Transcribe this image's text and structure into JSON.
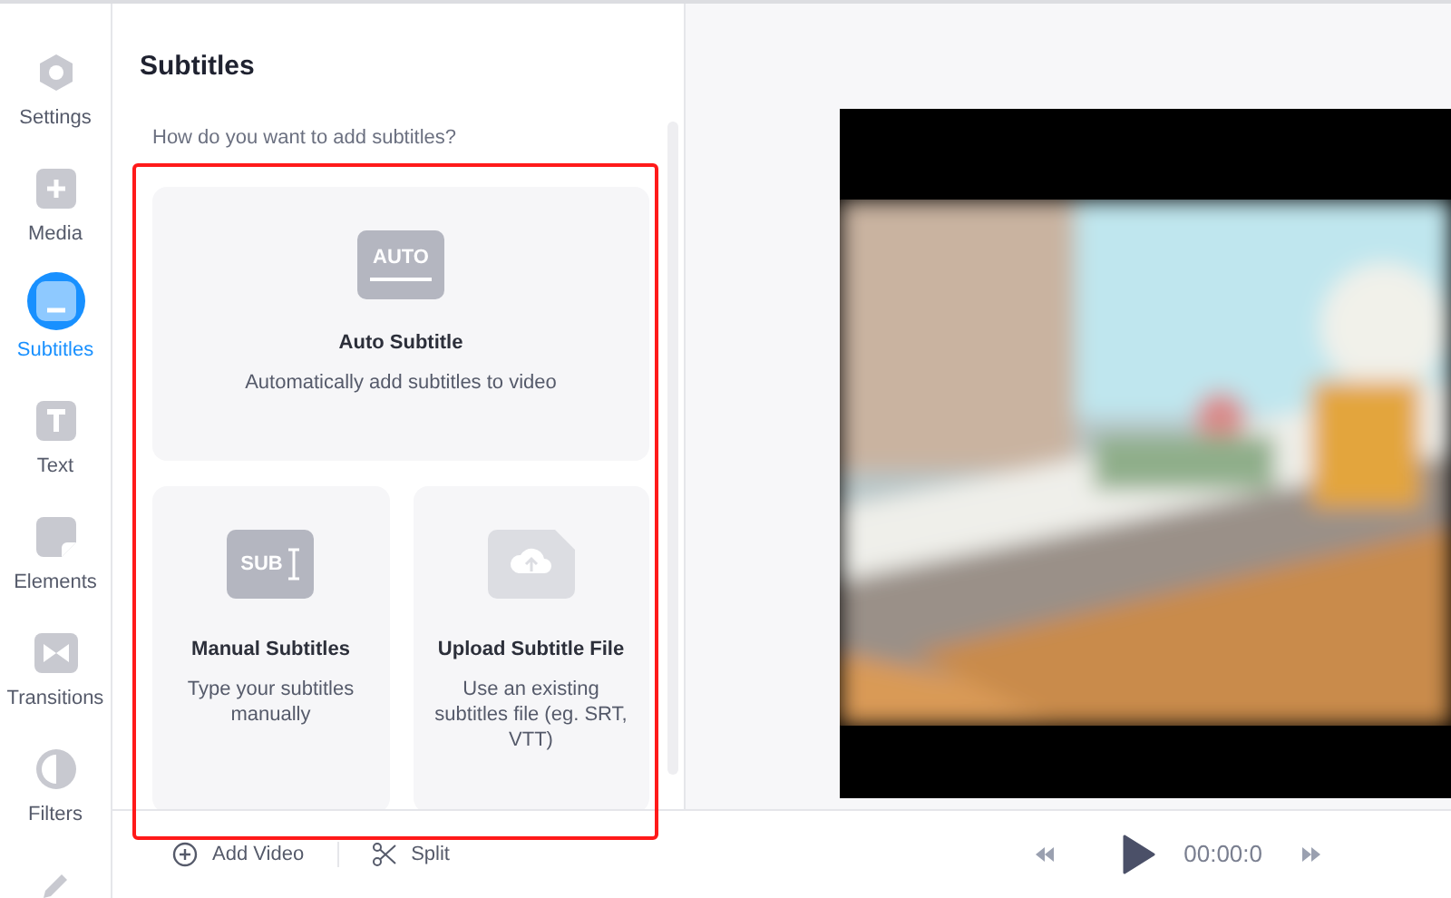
{
  "sidebar": {
    "items": [
      {
        "kind": "settings",
        "label": "Settings",
        "selected": false
      },
      {
        "kind": "media",
        "label": "Media",
        "selected": false
      },
      {
        "kind": "subtitles",
        "label": "Subtitles",
        "selected": true
      },
      {
        "kind": "text",
        "label": "Text",
        "selected": false
      },
      {
        "kind": "elements",
        "label": "Elements",
        "selected": false
      },
      {
        "kind": "transitions",
        "label": "Transitions",
        "selected": false
      },
      {
        "kind": "filters",
        "label": "Filters",
        "selected": false
      },
      {
        "kind": "edit",
        "selected": false
      }
    ]
  },
  "panel": {
    "title": "Subtitles",
    "prompt": "How do you want to add subtitles?",
    "options": [
      {
        "kind": "auto",
        "icon_text": "AUTO",
        "title": "Auto Subtitle",
        "description": "Automatically add subtitles to video"
      },
      {
        "kind": "manual",
        "icon_text": "SUB",
        "title": "Manual Subtitles",
        "description": "Type your subtitles manually"
      },
      {
        "kind": "upload",
        "title": "Upload Subtitle File",
        "description": "Use an existing subtitles file (eg. SRT, VTT)"
      }
    ]
  },
  "toolbar": [
    {
      "kind": "add",
      "label": "Add Video"
    },
    {
      "kind": "split",
      "label": "Split"
    }
  ],
  "player": {
    "time": "00:00:0"
  }
}
